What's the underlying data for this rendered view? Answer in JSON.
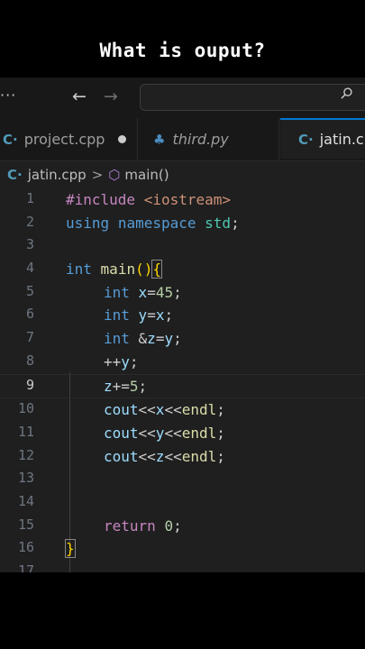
{
  "caption": "What is ouput?",
  "toolbar": {
    "menu_label": "···",
    "back_arrow": "←",
    "forward_arrow": "→",
    "search_placeholder": ""
  },
  "tabs": [
    {
      "label": "project.cpp",
      "icon": "cpp-file-icon",
      "modified": true
    },
    {
      "label": "third.py",
      "icon": "python-file-icon"
    },
    {
      "label": "jatin.cpp",
      "icon": "cpp-file-icon",
      "active": true
    }
  ],
  "breadcrumb": {
    "file": "jatin.cpp",
    "separator": ">",
    "symbol": "main()"
  },
  "code": {
    "active_line": 9,
    "lines": [
      {
        "n": "1",
        "text": "#include <iostream>"
      },
      {
        "n": "2",
        "text": "using namespace std;"
      },
      {
        "n": "3",
        "text": ""
      },
      {
        "n": "4",
        "text": "int main(){"
      },
      {
        "n": "5",
        "text": "int x=45;"
      },
      {
        "n": "6",
        "text": "int y=x;"
      },
      {
        "n": "7",
        "text": "int &z=y;"
      },
      {
        "n": "8",
        "text": "++y;"
      },
      {
        "n": "9",
        "text": "z+=5;"
      },
      {
        "n": "10",
        "text": "cout<<x<<endl;"
      },
      {
        "n": "11",
        "text": "cout<<y<<endl;"
      },
      {
        "n": "12",
        "text": "cout<<z<<endl;"
      },
      {
        "n": "13",
        "text": ""
      },
      {
        "n": "14",
        "text": ""
      },
      {
        "n": "15",
        "text": "return 0;"
      },
      {
        "n": "16",
        "text": "}"
      },
      {
        "n": "17",
        "text": ""
      }
    ]
  }
}
